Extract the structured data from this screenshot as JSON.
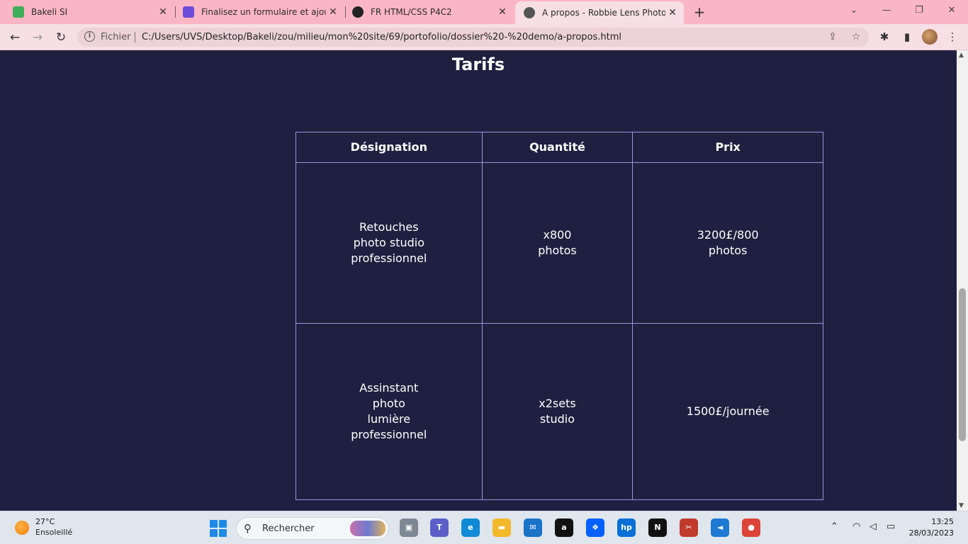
{
  "browser": {
    "tabs": [
      {
        "title": "Bakeli SI",
        "favicon_color": "#3fae5a",
        "active": false
      },
      {
        "title": "Finalisez un formulaire et ajoutez",
        "favicon_color": "#6e4bd8",
        "active": false
      },
      {
        "title": "FR HTML/CSS P4C2",
        "favicon_color": "#222222",
        "active": false
      },
      {
        "title": "A propos - Robbie Lens Photogra",
        "favicon_color": "#555555",
        "active": true
      }
    ],
    "new_tab_label": "+",
    "address": {
      "scheme_label": "Fichier",
      "url": "C:/Users/UVS/Desktop/Bakeli/zou/milieu/mon%20site/69/portofolio/dossier%20-%20demo/a-propos.html"
    },
    "colors": {
      "tabstrip": "#fbb6c5",
      "toolbar": "#f7dfe5"
    }
  },
  "page": {
    "heading": "Tarifs",
    "background": "#1f2040",
    "table": {
      "headers": [
        "Désignation",
        "Quantité",
        "Prix"
      ],
      "rows": [
        [
          "Retouches\nphoto studio\nprofessionnel",
          "x800\nphotos",
          "3200£/800\nphotos"
        ],
        [
          "Assinstant\nphoto\nlumière\nprofessionnel",
          "x2sets\nstudio",
          "1500£/journée"
        ]
      ],
      "border_color": "#8f9bd8"
    }
  },
  "taskbar": {
    "weather": {
      "temp": "27°C",
      "desc": "Ensoleillé"
    },
    "search_label": "Rechercher",
    "apps": [
      {
        "name": "task-view",
        "color": "#7b8794",
        "glyph": "▣"
      },
      {
        "name": "teams",
        "color": "#5b5fc7",
        "glyph": "T"
      },
      {
        "name": "edge",
        "color": "#0f8bd6",
        "glyph": "e"
      },
      {
        "name": "file-explorer",
        "color": "#f3b829",
        "glyph": "▬"
      },
      {
        "name": "mail",
        "color": "#1a73c9",
        "glyph": "✉"
      },
      {
        "name": "amazon",
        "color": "#111111",
        "glyph": "a"
      },
      {
        "name": "dropbox",
        "color": "#0061fe",
        "glyph": "❖"
      },
      {
        "name": "myhp",
        "color": "#0a6fd6",
        "glyph": "hp"
      },
      {
        "name": "netflix",
        "color": "#111111",
        "glyph": "N"
      },
      {
        "name": "snipping-tool",
        "color": "#c0392b",
        "glyph": "✂"
      },
      {
        "name": "vscode",
        "color": "#1e7ad3",
        "glyph": "◄"
      },
      {
        "name": "chrome",
        "color": "#db4437",
        "glyph": "●"
      }
    ],
    "clock": {
      "time": "13:25",
      "date": "28/03/2023"
    }
  }
}
